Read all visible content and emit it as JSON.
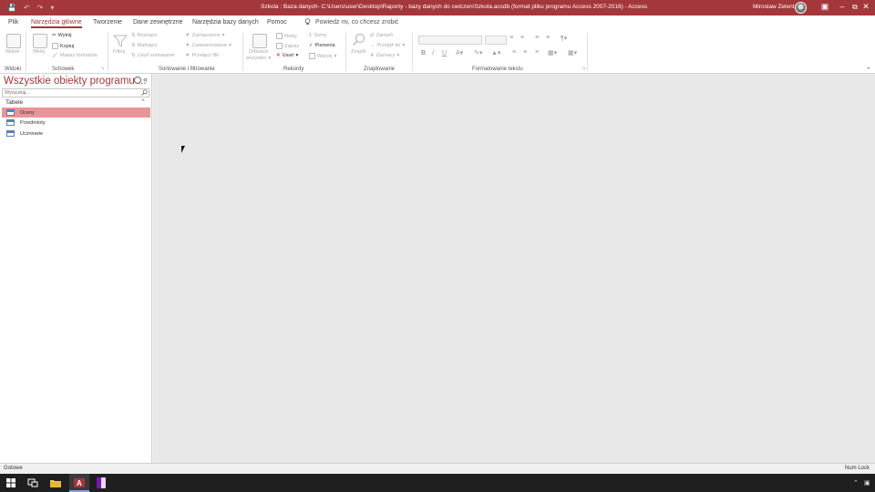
{
  "window": {
    "title": "Szkola : Baza danych- C:\\Users\\user\\Desktop\\Raporty - bazy danych do cwiczen\\Szkola.accdb (format pliku programu Access 2007-2016)  -  Access",
    "user": "Miroslaw Zelent",
    "accent": "#a4373a"
  },
  "tabs": [
    "Plik",
    "Narzędzia główne",
    "Tworzenie",
    "Dane zewnętrzne",
    "Narzędzia bazy danych",
    "Pomoc"
  ],
  "tellme": "Powiedz mi, co chcesz zrobić",
  "ribbon": {
    "groups": {
      "widoki": "Widoki",
      "schowek": "Schowek",
      "sortowanie": "Sortowanie i filtrowanie",
      "rekordy": "Rekordy",
      "znajdowanie": "Znajdowanie",
      "formatowanie": "Formatowanie tekstu"
    },
    "widok": "Widok",
    "wklej": "Wklej",
    "wytnij": "Wytnij",
    "kopiuj": "Kopiuj",
    "malarz": "Malarz formatów",
    "filtruj": "Filtruj",
    "rosnaco": "Rosnąco",
    "malejaco": "Malejąco",
    "usun_sortowanie": "Usuń sortowanie",
    "zaznaczenie": "Zaznaczenie",
    "zaawansowane": "Zaawansowane",
    "przelacz_filtr": "Przełącz filtr",
    "odswiez": "Odśwież",
    "wszystko": "wszystko",
    "nowy": "Nowy",
    "zapisz": "Zapisz",
    "usun": "Usuń",
    "sumy": "Sumy",
    "pisownia": "Pisownia",
    "wiecej": "Więcej",
    "znajdz": "Znajdź",
    "zamien": "Zamień",
    "przejdz_do": "Przejdź do",
    "zaznacz": "Zaznacz"
  },
  "nav": {
    "title": "Wszystkie obiekty programu ...",
    "search_placeholder": "Wyszukaj...",
    "section": "Tabele",
    "items": [
      "Oceny",
      "Przedmioty",
      "Uczniowie"
    ],
    "selected_index": 0
  },
  "status": {
    "left": "Gotowe",
    "right": "Num Lock"
  },
  "taskbar": {
    "apps": [
      "start-icon",
      "task-view-icon",
      "file-explorer-icon",
      "access-icon",
      "onenote-icon"
    ]
  }
}
